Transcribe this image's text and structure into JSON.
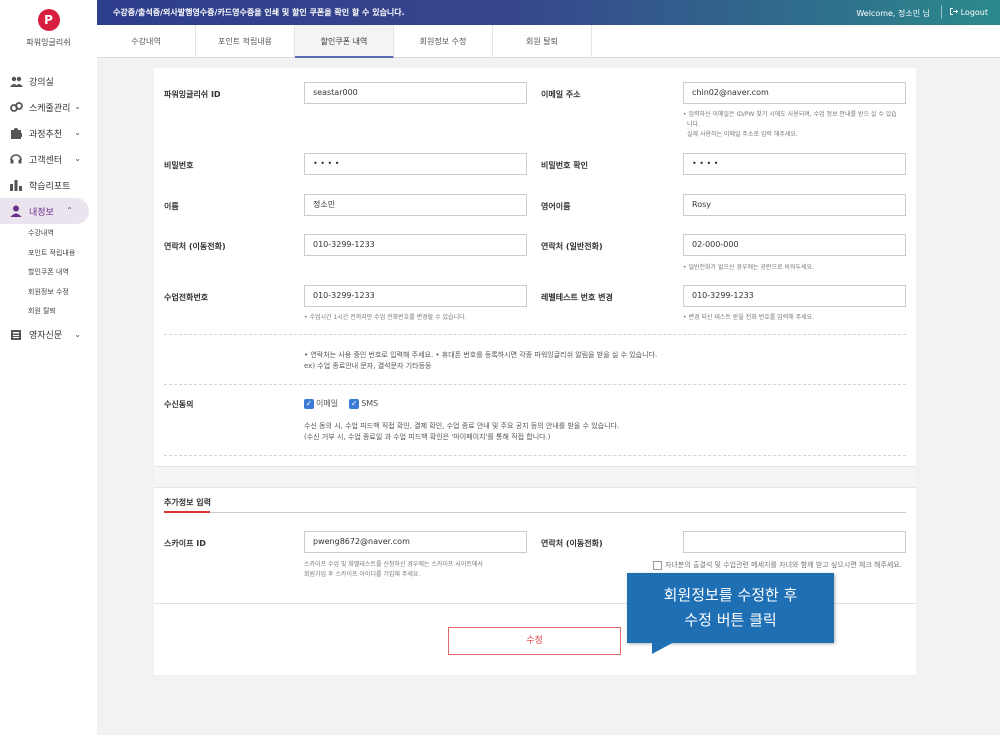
{
  "brand": {
    "logo_letter": "P",
    "name": "파워잉글리쉬",
    "accent": "#d61f3f"
  },
  "header": {
    "notice": "수강증/출석증/외사발행영수증/카드영수증을 인쇄 및 할인 쿠폰을 확인 할 수 있습니다.",
    "welcome": "Welcome, 정소민 님",
    "logout": "Logout"
  },
  "tabs": [
    {
      "label": "수강내역",
      "active": false
    },
    {
      "label": "포인트 적립내용",
      "active": false
    },
    {
      "label": "할인쿠폰 내역",
      "active": true
    },
    {
      "label": "회원정보 수정",
      "active": false
    },
    {
      "label": "회원 탈퇴",
      "active": false
    }
  ],
  "sidebar": {
    "items": [
      {
        "label": "강의실",
        "icon": "people-icon",
        "chevron": false
      },
      {
        "label": "스케줄관리",
        "icon": "link-icon",
        "chevron": true
      },
      {
        "label": "과정추천",
        "icon": "puzzle-icon",
        "chevron": true
      },
      {
        "label": "고객센터",
        "icon": "headset-icon",
        "chevron": true
      },
      {
        "label": "학습리포트",
        "icon": "bar-chart-icon",
        "chevron": false
      },
      {
        "label": "내정보",
        "icon": "user-icon",
        "chevron": true,
        "active": true
      }
    ],
    "subitems": [
      "수강내역",
      "포인트 적립내용",
      "할인쿠폰 내역",
      "회원정보 수정",
      "회원 탈퇴"
    ],
    "last_item": {
      "label": "영자신문",
      "icon": "newspaper-icon",
      "chevron": true
    }
  },
  "form": {
    "id_label": "파워잉글리쉬 ID",
    "id_value": "seastar000",
    "email_label": "이메일 주소",
    "email_value": "chin02@naver.com",
    "email_hint_1": "• 입력하신 이메일은 ID/PW 찾기 시에도 사용되며, 수업 정보 안내를 받으 실 수 있습",
    "email_hint_2": "니다.",
    "email_hint_3": "실제 사용하는 이메일 주소로 입력 해주세요.",
    "pw_label": "비밀번호",
    "pw_value": "• • • •",
    "pw_confirm_label": "비밀번호 확인",
    "pw_confirm_value": "• • • •",
    "name_label": "이름",
    "name_value": "정소민",
    "eng_name_label": "영어이름",
    "eng_name_value": "Rosy",
    "mobile_label": "연락처 (이동전화)",
    "mobile_value": "010-3299-1233",
    "phone_label": "연락처 (일반전화)",
    "phone_value": "02-000-000",
    "phone_hint": "• 일반전화가 없으신 경우에는 공란으로 비워두세요.",
    "class_phone_label": "수업전화번호",
    "class_phone_value": "010-3299-1233",
    "class_phone_hint": "• 수업시간 1시간 전까지만 수업 전화번호를 변경할 수 있습니다.",
    "level_test_label": "레벨테스트 번호 변경",
    "level_test_value": "010-3299-1233",
    "level_test_hint": "• 변경 되신 테스트 받을 전화 번호를 입력해 주세요.",
    "contact_note_1": "• 연락처는 사용 중인 번호로 입력해 주세요.  • 휴대폰 번호를 등록하시면 각종 파워잉글리쉬 알림을 받을 실 수 있습니다.",
    "contact_note_2": "ex) 수업 종료안내 문자, 결석문자 기타등등",
    "consent_label": "수신동의",
    "consent_email": "이메일",
    "consent_sms": "SMS",
    "consent_note_1": "수신 동의 시, 수업 피드백 직접 확인, 결제 확인, 수업 종료 안내 및 주요 공지 등의 안내를 받을 수 있습니다.",
    "consent_note_2": "(수신 거부 시, 수업 종료일 과 수업 피드백 확인은 '마이페이지'를 통해 직접 합니다.)"
  },
  "extra": {
    "title": "추가정보 입력",
    "skype_label": "스카이프 ID",
    "skype_value": "pweng8672@naver.com",
    "skype_hint_1": "스카이프 수업 및 화벨테스트를 신청하신 경우에는 스카이프 사이트에서",
    "skype_hint_2": "회원가입 후 스카이프 아이디를 기입해 주세요.",
    "guardian_label": "연락처 (이동전화)",
    "guardian_value": "",
    "guardian_check": "자녀분의 출결석 및 수업관련 메세지를 자녀와 함께 받고 싶으시면 체크 해주세요."
  },
  "submit_label": "수정",
  "tooltip": {
    "line1": "회원정보를 수정한 후",
    "line2": "수정 버튼 클릭"
  }
}
